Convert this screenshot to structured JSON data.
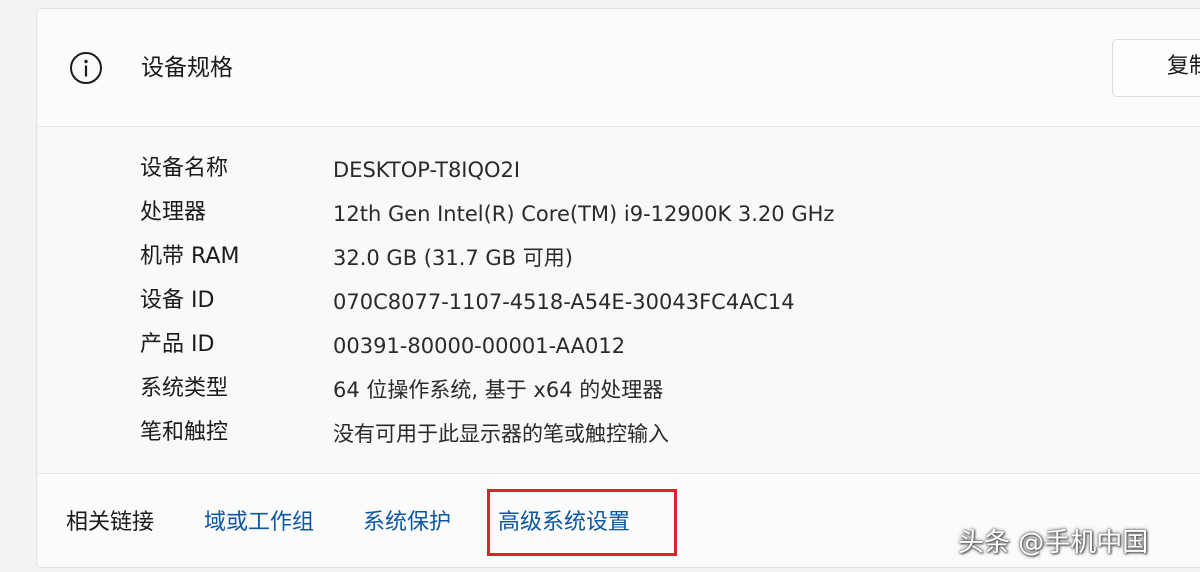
{
  "header": {
    "title": "设备规格",
    "info_icon": "info-circle-icon",
    "copy_label": "复制"
  },
  "specs": [
    {
      "label": "设备名称",
      "value": "DESKTOP-T8IQO2I"
    },
    {
      "label": "处理器",
      "value": "12th Gen Intel(R) Core(TM) i9-12900K   3.20 GHz"
    },
    {
      "label": "机带 RAM",
      "value": "32.0 GB (31.7 GB 可用)"
    },
    {
      "label": "设备 ID",
      "value": "070C8077-1107-4518-A54E-30043FC4AC14"
    },
    {
      "label": "产品 ID",
      "value": "00391-80000-00001-AA012"
    },
    {
      "label": "系统类型",
      "value": "64 位操作系统, 基于 x64 的处理器"
    },
    {
      "label": "笔和触控",
      "value": "没有可用于此显示器的笔或触控输入"
    }
  ],
  "links": {
    "title": "相关链接",
    "items": [
      {
        "label": "域或工作组"
      },
      {
        "label": "系统保护"
      },
      {
        "label": "高级系统设置",
        "highlighted": true
      }
    ]
  },
  "watermark": {
    "text": "头条 @手机中国"
  },
  "colors": {
    "link": "#0b57a4",
    "highlight": "#d9232d"
  }
}
